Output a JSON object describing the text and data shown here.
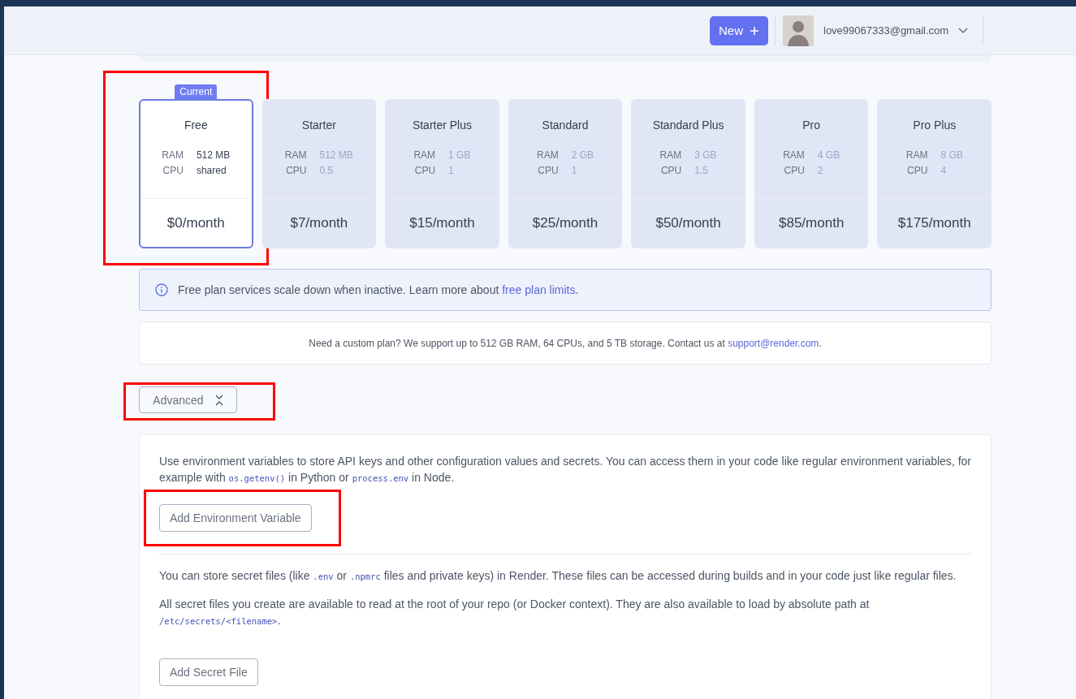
{
  "header": {
    "new_button": "New",
    "account_email": "love99067333@gmail.com"
  },
  "plans": [
    {
      "name": "Free",
      "ram_label": "RAM",
      "ram": "512 MB",
      "cpu_label": "CPU",
      "cpu": "shared",
      "price": "$0/month",
      "selected": true,
      "badge": "Current",
      "highlighted": true
    },
    {
      "name": "Starter",
      "ram_label": "RAM",
      "ram": "512 MB",
      "cpu_label": "CPU",
      "cpu": "0.5",
      "price": "$7/month",
      "selected": false,
      "highlighted": false
    },
    {
      "name": "Starter Plus",
      "ram_label": "RAM",
      "ram": "1 GB",
      "cpu_label": "CPU",
      "cpu": "1",
      "price": "$15/month",
      "selected": false,
      "highlighted": false
    },
    {
      "name": "Standard",
      "ram_label": "RAM",
      "ram": "2 GB",
      "cpu_label": "CPU",
      "cpu": "1",
      "price": "$25/month",
      "selected": false,
      "highlighted": false
    },
    {
      "name": "Standard Plus",
      "ram_label": "RAM",
      "ram": "3 GB",
      "cpu_label": "CPU",
      "cpu": "1.5",
      "price": "$50/month",
      "selected": false,
      "highlighted": false
    },
    {
      "name": "Pro",
      "ram_label": "RAM",
      "ram": "4 GB",
      "cpu_label": "CPU",
      "cpu": "2",
      "price": "$85/month",
      "selected": false,
      "highlighted": false
    },
    {
      "name": "Pro Plus",
      "ram_label": "RAM",
      "ram": "8 GB",
      "cpu_label": "CPU",
      "cpu": "4",
      "price": "$175/month",
      "selected": false,
      "highlighted": false
    }
  ],
  "info_alert": {
    "text": "Free plan services scale down when inactive. Learn more about ",
    "link": "free plan limits",
    "end": "."
  },
  "custom_plan": {
    "text": "Need a custom plan? We support up to 512 GB RAM, 64 CPUs, and 5 TB storage. Contact us at ",
    "link": "support@render.com",
    "end": "."
  },
  "advanced": {
    "label": "Advanced",
    "expanded": true,
    "highlighted": true
  },
  "env_section": {
    "paragraph": [
      {
        "text": "Use environment variables to store API keys and other configuration values and secrets. You can access them in your code like regular environment variables, for example with ",
        "code": false
      },
      {
        "text": "os.getenv()",
        "code": true
      },
      {
        "text": " in Python or ",
        "code": false
      },
      {
        "text": "process.env",
        "code": true
      },
      {
        "text": " in Node.",
        "code": false
      }
    ],
    "button": "Add Environment Variable",
    "button_highlighted": true
  },
  "secret_section": {
    "paragraphs": [
      [
        {
          "text": "You can store secret files (like ",
          "code": false
        },
        {
          "text": ".env",
          "code": true
        },
        {
          "text": " or ",
          "code": false
        },
        {
          "text": ".npmrc",
          "code": true
        },
        {
          "text": " files and private keys) in Render. These files can be accessed during builds and in your code just like regular files.",
          "code": false
        }
      ],
      [
        {
          "text": "All secret files you create are available to read at the root of your repo (or Docker context). They are also available to load by absolute path at ",
          "code": false
        },
        {
          "text": "/etc/secrets/<filename>",
          "code": true
        },
        {
          "text": ".",
          "code": false
        }
      ]
    ],
    "button": "Add Secret File"
  }
}
